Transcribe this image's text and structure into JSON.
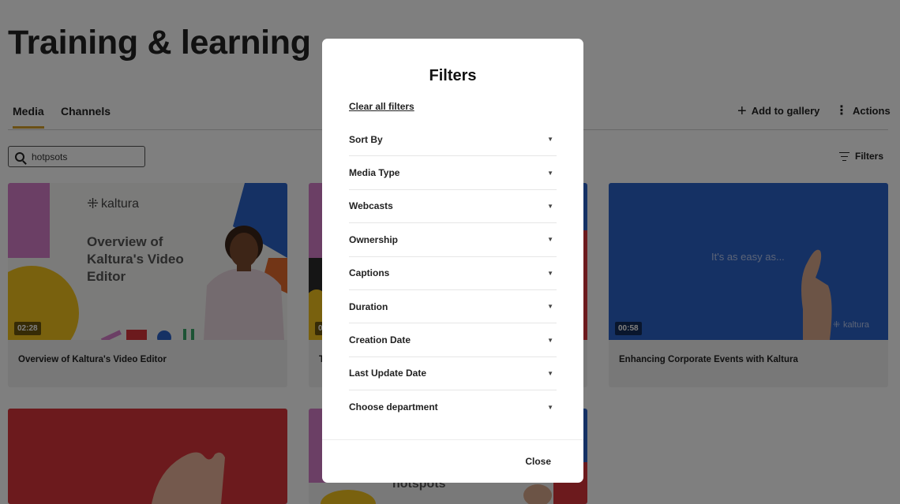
{
  "page": {
    "title": "Training & learning"
  },
  "tabs": [
    {
      "label": "Media"
    },
    {
      "label": "Channels"
    }
  ],
  "toolbar": {
    "add_to_gallery": "Add to gallery",
    "actions": "Actions",
    "filters": "Filters"
  },
  "search": {
    "value": "hotpsots"
  },
  "cards": [
    {
      "title": "Overview of Kaltura's Video Editor",
      "duration": "02:28",
      "thumb_brand": "kaltura",
      "thumb_text": "Overview of Kaltura's Video Editor"
    },
    {
      "title": "T",
      "duration": "0",
      "thumb_text": "hotspots"
    },
    {
      "title": "Enhancing Corporate Events with Kaltura",
      "duration": "00:58",
      "thumb_text": "It's as easy as...",
      "thumb_brand": "kaltura"
    }
  ],
  "colors": {
    "accent": "#d7a12a",
    "card_blue": "#2a62c9",
    "card_red": "#d9343b",
    "card_pink": "#d77fcb",
    "card_yellow": "#f2c21c"
  },
  "modal": {
    "title": "Filters",
    "clear_all": "Clear all filters",
    "filters": [
      {
        "label": "Sort By"
      },
      {
        "label": "Media Type"
      },
      {
        "label": "Webcasts"
      },
      {
        "label": "Ownership"
      },
      {
        "label": "Captions"
      },
      {
        "label": "Duration"
      },
      {
        "label": "Creation Date"
      },
      {
        "label": "Last Update Date"
      },
      {
        "label": "Choose department"
      }
    ],
    "close": "Close"
  }
}
